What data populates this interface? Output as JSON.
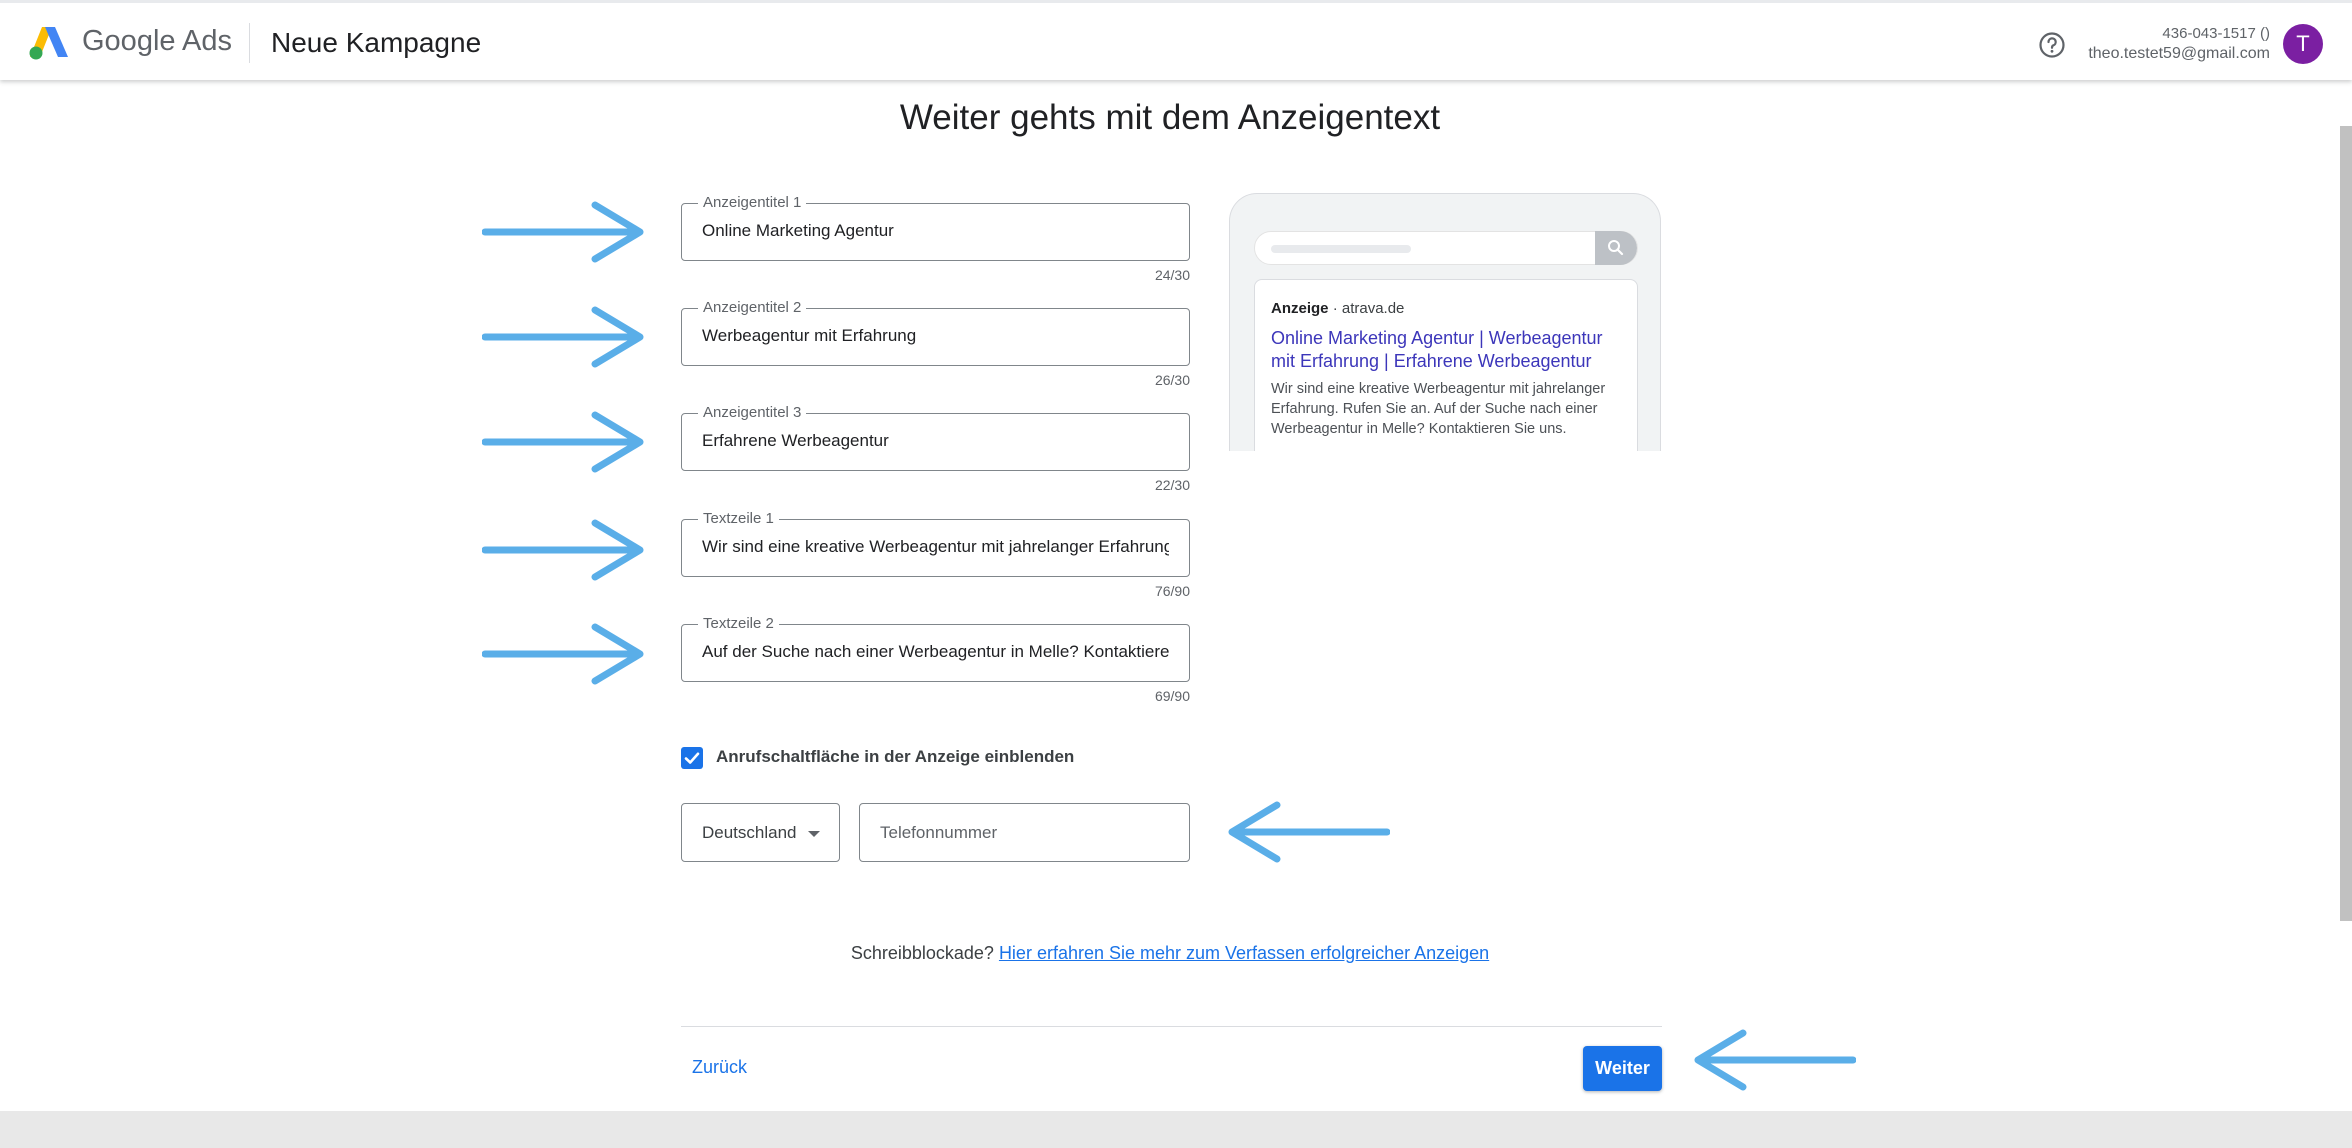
{
  "header": {
    "brand": "Google Ads",
    "campaign_title": "Neue Kampagne",
    "account_id": "436-043-1517 ()",
    "account_email": "theo.testet59@gmail.com",
    "avatar_letter": "T",
    "icons": [
      "google-ads-logo",
      "help-circle-icon"
    ]
  },
  "page_heading": "Weiter gehts mit dem Anzeigentext",
  "fields": [
    {
      "label": "Anzeigentitel 1",
      "value": "Online Marketing Agentur",
      "counter": "24/30"
    },
    {
      "label": "Anzeigentitel 2",
      "value": "Werbeagentur mit Erfahrung",
      "counter": "26/30"
    },
    {
      "label": "Anzeigentitel 3",
      "value": "Erfahrene Werbeagentur",
      "counter": "22/30"
    },
    {
      "label": "Textzeile 1",
      "value": "Wir sind eine kreative Werbeagentur mit jahrelanger Erfahrung. Rufen Sie an.",
      "counter": "76/90"
    },
    {
      "label": "Textzeile 2",
      "value": "Auf der Suche nach einer Werbeagentur in Melle? Kontaktieren Sie uns.",
      "counter": "69/90"
    }
  ],
  "preview": {
    "ad_badge": "Anzeige",
    "separator": "·",
    "domain": "atrava.de",
    "headline": "Online Marketing Agentur | Werbeagentur mit Erfahrung | Erfahrene Werbeagentur",
    "description": "Wir sind eine kreative Werbeagentur mit jahrelanger Erfahrung. Rufen Sie an. Auf der Suche nach einer Werbeagentur in Melle? Kontaktieren Sie uns."
  },
  "call_button": {
    "checked": true,
    "label": "Anrufschaltfläche in der Anzeige einblenden",
    "country": "Deutschland",
    "phone_placeholder": "Telefonnummer"
  },
  "writer_block": {
    "text": "Schreibblockade?",
    "link": "Hier erfahren Sie mehr zum Verfassen erfolgreicher Anzeigen"
  },
  "nav": {
    "back": "Zurück",
    "next": "Weiter"
  },
  "colors": {
    "accent": "#1a73e8",
    "annotation_arrow": "#5aaee8",
    "avatar": "#7b1fa2",
    "ad_headline": "#3c36ba"
  }
}
